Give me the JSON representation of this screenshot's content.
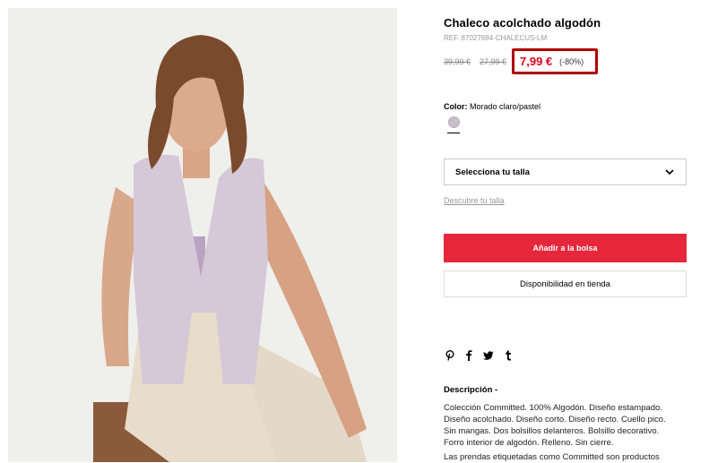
{
  "product": {
    "title": "Chaleco acolchado algodón",
    "ref": "REF. 87027884-CHALECUS-LM",
    "original_price": "39,99 €",
    "previous_price": "27,99 €",
    "current_price": "7,99 €",
    "discount": "(-80%)"
  },
  "color": {
    "label": "Color:",
    "value": "Morado claro/pastel",
    "swatch_hex": "#c9bfca"
  },
  "size": {
    "select_label": "Selecciona tu talla",
    "guide_link": "Descubre tu talla"
  },
  "actions": {
    "add_to_bag": "Añadir a la bolsa",
    "store_availability": "Disponibilidad en tienda"
  },
  "share": {
    "icons": [
      "pinterest-icon",
      "facebook-icon",
      "twitter-icon",
      "tumblr-icon"
    ]
  },
  "description": {
    "title": "Descripción -",
    "lines": [
      "Colección Committed. 100% Algodón. Diseño estampado.",
      "Diseño acolchado. Diseño corto. Diseño recto. Cuello pico.",
      "Sin mangas. Dos bolsillos delanteros. Bolsillo decorativo.",
      "Forro interior de algodón. Relleno. Sin cierre.",
      "Las prendas etiquetadas como Committed son productos"
    ]
  },
  "colors": {
    "accent_red": "#e6263a",
    "price_red": "#e2001a",
    "highlight_box": "#b00000"
  }
}
